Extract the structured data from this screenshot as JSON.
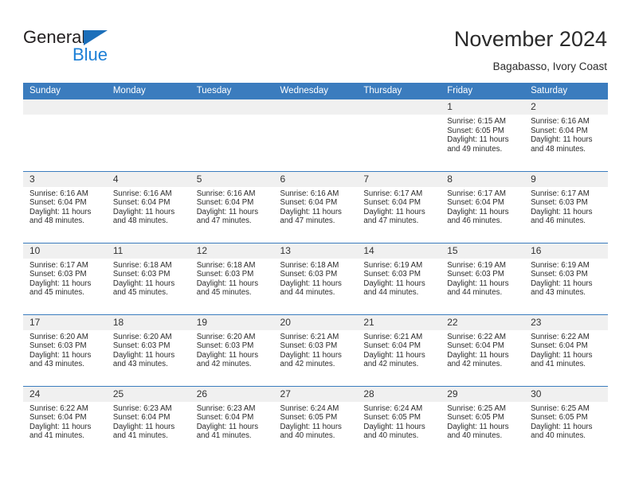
{
  "brand": {
    "name_dark": "General",
    "name_blue": "Blue",
    "logo_icon": "triangle-icon",
    "accent_color": "#1c7fd6",
    "header_color": "#3b7cbe"
  },
  "header": {
    "title": "November 2024",
    "subtitle": "Bagabasso, Ivory Coast"
  },
  "calendar": {
    "weekday_headers": [
      "Sunday",
      "Monday",
      "Tuesday",
      "Wednesday",
      "Thursday",
      "Friday",
      "Saturday"
    ],
    "weeks": [
      [
        {
          "day": "",
          "empty": true
        },
        {
          "day": "",
          "empty": true
        },
        {
          "day": "",
          "empty": true
        },
        {
          "day": "",
          "empty": true
        },
        {
          "day": "",
          "empty": true
        },
        {
          "day": "1",
          "sunrise": "Sunrise: 6:15 AM",
          "sunset": "Sunset: 6:05 PM",
          "daylight_1": "Daylight: 11 hours",
          "daylight_2": "and 49 minutes."
        },
        {
          "day": "2",
          "sunrise": "Sunrise: 6:16 AM",
          "sunset": "Sunset: 6:04 PM",
          "daylight_1": "Daylight: 11 hours",
          "daylight_2": "and 48 minutes."
        }
      ],
      [
        {
          "day": "3",
          "sunrise": "Sunrise: 6:16 AM",
          "sunset": "Sunset: 6:04 PM",
          "daylight_1": "Daylight: 11 hours",
          "daylight_2": "and 48 minutes."
        },
        {
          "day": "4",
          "sunrise": "Sunrise: 6:16 AM",
          "sunset": "Sunset: 6:04 PM",
          "daylight_1": "Daylight: 11 hours",
          "daylight_2": "and 48 minutes."
        },
        {
          "day": "5",
          "sunrise": "Sunrise: 6:16 AM",
          "sunset": "Sunset: 6:04 PM",
          "daylight_1": "Daylight: 11 hours",
          "daylight_2": "and 47 minutes."
        },
        {
          "day": "6",
          "sunrise": "Sunrise: 6:16 AM",
          "sunset": "Sunset: 6:04 PM",
          "daylight_1": "Daylight: 11 hours",
          "daylight_2": "and 47 minutes."
        },
        {
          "day": "7",
          "sunrise": "Sunrise: 6:17 AM",
          "sunset": "Sunset: 6:04 PM",
          "daylight_1": "Daylight: 11 hours",
          "daylight_2": "and 47 minutes."
        },
        {
          "day": "8",
          "sunrise": "Sunrise: 6:17 AM",
          "sunset": "Sunset: 6:04 PM",
          "daylight_1": "Daylight: 11 hours",
          "daylight_2": "and 46 minutes."
        },
        {
          "day": "9",
          "sunrise": "Sunrise: 6:17 AM",
          "sunset": "Sunset: 6:03 PM",
          "daylight_1": "Daylight: 11 hours",
          "daylight_2": "and 46 minutes."
        }
      ],
      [
        {
          "day": "10",
          "sunrise": "Sunrise: 6:17 AM",
          "sunset": "Sunset: 6:03 PM",
          "daylight_1": "Daylight: 11 hours",
          "daylight_2": "and 45 minutes."
        },
        {
          "day": "11",
          "sunrise": "Sunrise: 6:18 AM",
          "sunset": "Sunset: 6:03 PM",
          "daylight_1": "Daylight: 11 hours",
          "daylight_2": "and 45 minutes."
        },
        {
          "day": "12",
          "sunrise": "Sunrise: 6:18 AM",
          "sunset": "Sunset: 6:03 PM",
          "daylight_1": "Daylight: 11 hours",
          "daylight_2": "and 45 minutes."
        },
        {
          "day": "13",
          "sunrise": "Sunrise: 6:18 AM",
          "sunset": "Sunset: 6:03 PM",
          "daylight_1": "Daylight: 11 hours",
          "daylight_2": "and 44 minutes."
        },
        {
          "day": "14",
          "sunrise": "Sunrise: 6:19 AM",
          "sunset": "Sunset: 6:03 PM",
          "daylight_1": "Daylight: 11 hours",
          "daylight_2": "and 44 minutes."
        },
        {
          "day": "15",
          "sunrise": "Sunrise: 6:19 AM",
          "sunset": "Sunset: 6:03 PM",
          "daylight_1": "Daylight: 11 hours",
          "daylight_2": "and 44 minutes."
        },
        {
          "day": "16",
          "sunrise": "Sunrise: 6:19 AM",
          "sunset": "Sunset: 6:03 PM",
          "daylight_1": "Daylight: 11 hours",
          "daylight_2": "and 43 minutes."
        }
      ],
      [
        {
          "day": "17",
          "sunrise": "Sunrise: 6:20 AM",
          "sunset": "Sunset: 6:03 PM",
          "daylight_1": "Daylight: 11 hours",
          "daylight_2": "and 43 minutes."
        },
        {
          "day": "18",
          "sunrise": "Sunrise: 6:20 AM",
          "sunset": "Sunset: 6:03 PM",
          "daylight_1": "Daylight: 11 hours",
          "daylight_2": "and 43 minutes."
        },
        {
          "day": "19",
          "sunrise": "Sunrise: 6:20 AM",
          "sunset": "Sunset: 6:03 PM",
          "daylight_1": "Daylight: 11 hours",
          "daylight_2": "and 42 minutes."
        },
        {
          "day": "20",
          "sunrise": "Sunrise: 6:21 AM",
          "sunset": "Sunset: 6:03 PM",
          "daylight_1": "Daylight: 11 hours",
          "daylight_2": "and 42 minutes."
        },
        {
          "day": "21",
          "sunrise": "Sunrise: 6:21 AM",
          "sunset": "Sunset: 6:04 PM",
          "daylight_1": "Daylight: 11 hours",
          "daylight_2": "and 42 minutes."
        },
        {
          "day": "22",
          "sunrise": "Sunrise: 6:22 AM",
          "sunset": "Sunset: 6:04 PM",
          "daylight_1": "Daylight: 11 hours",
          "daylight_2": "and 42 minutes."
        },
        {
          "day": "23",
          "sunrise": "Sunrise: 6:22 AM",
          "sunset": "Sunset: 6:04 PM",
          "daylight_1": "Daylight: 11 hours",
          "daylight_2": "and 41 minutes."
        }
      ],
      [
        {
          "day": "24",
          "sunrise": "Sunrise: 6:22 AM",
          "sunset": "Sunset: 6:04 PM",
          "daylight_1": "Daylight: 11 hours",
          "daylight_2": "and 41 minutes."
        },
        {
          "day": "25",
          "sunrise": "Sunrise: 6:23 AM",
          "sunset": "Sunset: 6:04 PM",
          "daylight_1": "Daylight: 11 hours",
          "daylight_2": "and 41 minutes."
        },
        {
          "day": "26",
          "sunrise": "Sunrise: 6:23 AM",
          "sunset": "Sunset: 6:04 PM",
          "daylight_1": "Daylight: 11 hours",
          "daylight_2": "and 41 minutes."
        },
        {
          "day": "27",
          "sunrise": "Sunrise: 6:24 AM",
          "sunset": "Sunset: 6:05 PM",
          "daylight_1": "Daylight: 11 hours",
          "daylight_2": "and 40 minutes."
        },
        {
          "day": "28",
          "sunrise": "Sunrise: 6:24 AM",
          "sunset": "Sunset: 6:05 PM",
          "daylight_1": "Daylight: 11 hours",
          "daylight_2": "and 40 minutes."
        },
        {
          "day": "29",
          "sunrise": "Sunrise: 6:25 AM",
          "sunset": "Sunset: 6:05 PM",
          "daylight_1": "Daylight: 11 hours",
          "daylight_2": "and 40 minutes."
        },
        {
          "day": "30",
          "sunrise": "Sunrise: 6:25 AM",
          "sunset": "Sunset: 6:05 PM",
          "daylight_1": "Daylight: 11 hours",
          "daylight_2": "and 40 minutes."
        }
      ]
    ]
  }
}
